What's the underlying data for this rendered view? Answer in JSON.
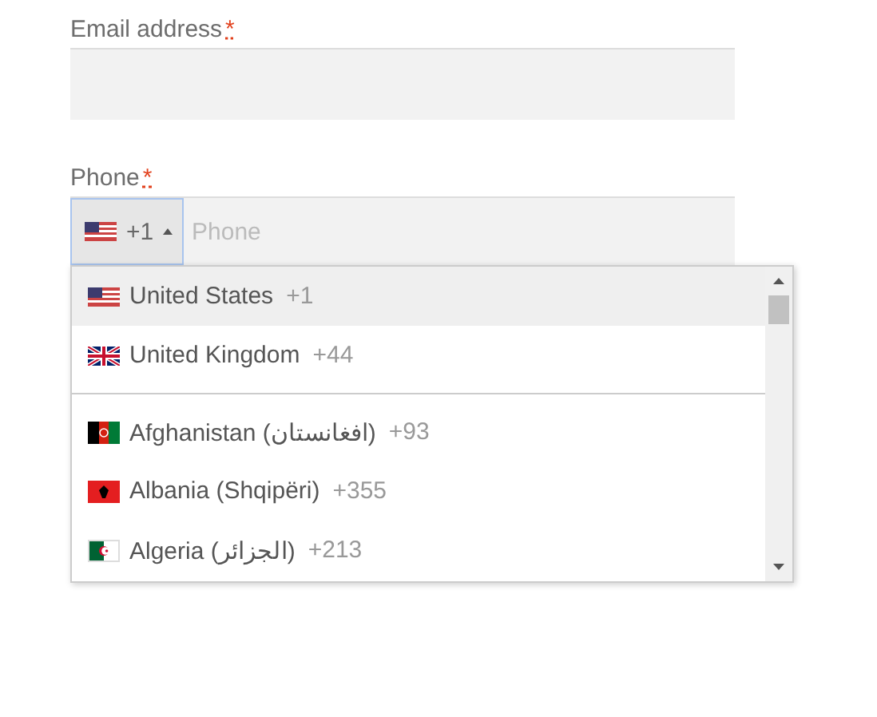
{
  "email": {
    "label": "Email address",
    "required_mark": "*"
  },
  "phone": {
    "label": "Phone",
    "required_mark": "*",
    "placeholder": "Phone",
    "dial_code": "+1",
    "dropdown_expanded": true
  },
  "preferred_countries": [
    {
      "name": "United States",
      "dial_code": "+1",
      "selected": true
    },
    {
      "name": "United Kingdom",
      "dial_code": "+44",
      "selected": false
    }
  ],
  "countries": [
    {
      "name": "Afghanistan (افغانستان)",
      "dial_code": "+93",
      "selected": false
    },
    {
      "name": "Albania (Shqipëri)",
      "dial_code": "+355",
      "selected": false
    },
    {
      "name": "Algeria (الجزائر)",
      "dial_code": "+213",
      "selected": false
    }
  ]
}
